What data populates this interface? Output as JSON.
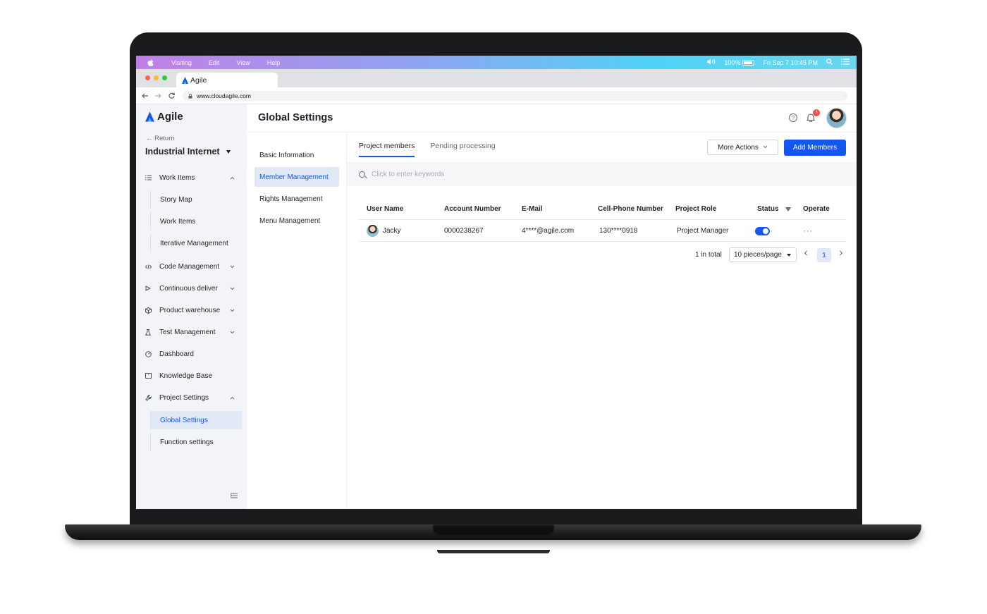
{
  "menubar": {
    "menus": [
      "Visiting",
      "Edit",
      "View",
      "Help"
    ],
    "battery": "100%",
    "datetime": "Fri Sep 7 10:45 PM"
  },
  "browser": {
    "tab_title": "Agile",
    "url": "www.cloudagile.com"
  },
  "sidebar": {
    "brand": "Agile",
    "return_label": "← Return",
    "project_name": "Industrial Internet",
    "items": [
      {
        "label": "Work Items",
        "icon": "list-icon",
        "chevron": "^"
      },
      {
        "label": "Story Map"
      },
      {
        "label": "Work Items"
      },
      {
        "label": "Iterative Management"
      },
      {
        "label": "Code Management",
        "icon": "code-icon",
        "chevron": "v"
      },
      {
        "label": "Continuous deliver",
        "icon": "play-icon",
        "chevron": "v"
      },
      {
        "label": "Product warehouse",
        "icon": "box-icon",
        "chevron": "v"
      },
      {
        "label": "Test Management",
        "icon": "flask-icon",
        "chevron": "v"
      },
      {
        "label": "Dashboard",
        "icon": "gauge-icon"
      },
      {
        "label": "Knowledge Base",
        "icon": "book-icon"
      },
      {
        "label": "Project Settings",
        "icon": "wrench-icon",
        "chevron": "^"
      },
      {
        "label": "Global Settings"
      },
      {
        "label": "Function settings"
      }
    ]
  },
  "header": {
    "title": "Global Settings",
    "notification_count": "3"
  },
  "subnav": {
    "items": [
      "Basic Information",
      "Member Management",
      "Rights Management",
      "Menu Management"
    ]
  },
  "content": {
    "tabs": [
      "Project members",
      "Pending processing"
    ],
    "more_actions_label": "More Actions",
    "add_members_label": "Add Members",
    "search_placeholder": "Click to enter keywords",
    "table": {
      "columns": [
        "User Name",
        "Account Number",
        "E-Mail",
        "Cell-Phone Number",
        "Project Role",
        "Status",
        "Operate"
      ],
      "rows": [
        {
          "user_name": "Jacky",
          "account_number": "0000238267",
          "email": "4****@agile.com",
          "phone": "130****0918",
          "role": "Project Manager",
          "status_on": true,
          "operate": "···"
        }
      ]
    },
    "pagination": {
      "total": "1 in total",
      "page_size": "10 pieces/page",
      "current_page": "1"
    }
  },
  "colors": {
    "accent": "#1456f0",
    "sidebar_bg": "#f2f4f7",
    "active_bg": "#e1e8f6"
  }
}
